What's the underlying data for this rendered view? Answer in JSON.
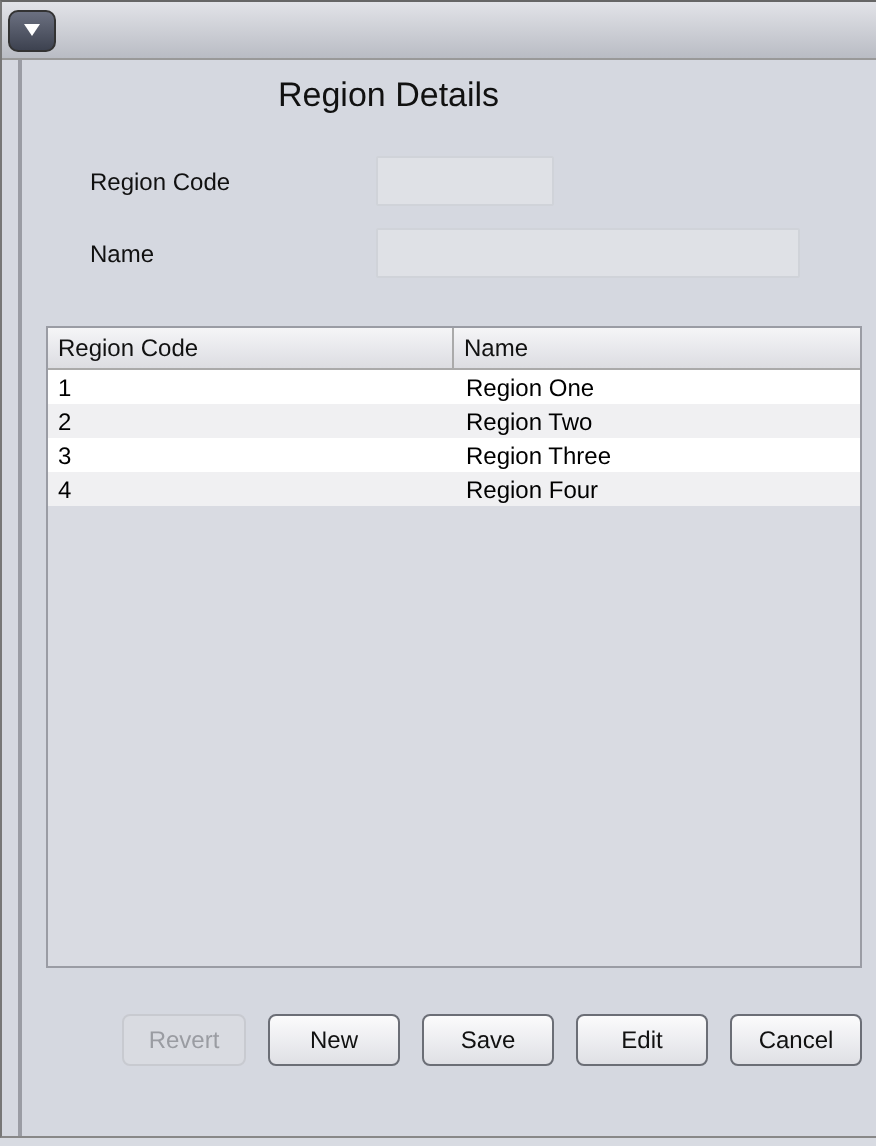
{
  "title": "Region Details",
  "fields": [
    {
      "label": "Region Code",
      "disabled": true,
      "kind": "code"
    },
    {
      "label": "Name",
      "disabled": true,
      "kind": "text"
    }
  ],
  "table": {
    "columns": [
      "Region Code",
      "Name"
    ],
    "rows": [
      {
        "cells": [
          "1",
          "Region One"
        ]
      },
      {
        "cells": [
          "2",
          "Region Two"
        ]
      },
      {
        "cells": [
          "3",
          "Region Three"
        ]
      },
      {
        "cells": [
          "4",
          "Region Four"
        ]
      }
    ]
  },
  "buttons": [
    {
      "label": "Revert",
      "disabled": true
    },
    {
      "label": "New",
      "disabled": false
    },
    {
      "label": "Save",
      "disabled": false
    },
    {
      "label": "Edit",
      "disabled": false
    },
    {
      "label": "Cancel",
      "disabled": false
    }
  ]
}
